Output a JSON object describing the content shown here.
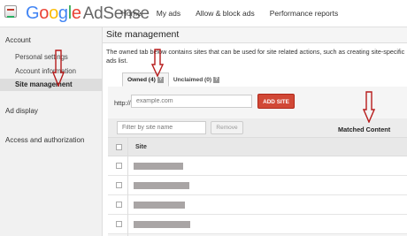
{
  "header": {
    "logo_letters": [
      "G",
      "o",
      "o",
      "g",
      "l",
      "e"
    ],
    "product": "AdSense",
    "nav": [
      "Home",
      "My ads",
      "Allow & block ads",
      "Performance reports"
    ]
  },
  "sidebar": {
    "account_heading": "Account",
    "items": [
      "Personal settings",
      "Account information",
      "Site management"
    ],
    "ad_display": "Ad display",
    "access": "Access and authorization"
  },
  "main": {
    "title": "Site management",
    "description": "The owned tab below contains sites that can be used for site related actions, such as creating site-specific ads list.",
    "tabs": [
      {
        "label": "Owned (4)",
        "help": "?"
      },
      {
        "label": "Unclaimed (0)",
        "help": "?"
      }
    ],
    "http_label": "http://",
    "url_placeholder": "example.com",
    "add_site": "ADD SITE",
    "filter_placeholder": "Filter by site name",
    "remove": "Remove",
    "matched_content": "Matched Content",
    "site_column": "Site",
    "row_count": 4
  },
  "colors": {
    "accent_red": "#d14836",
    "annotation_arrow": "#b71c1c"
  }
}
